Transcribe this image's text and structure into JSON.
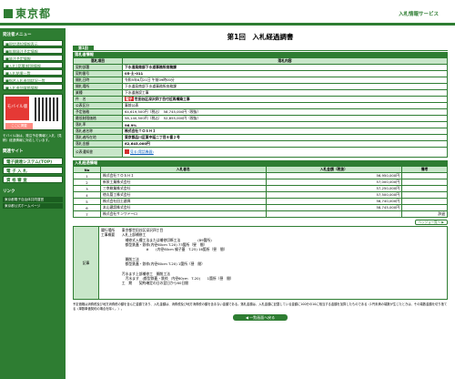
{
  "header": {
    "logo": "東京都",
    "right": "入札情報サービス"
  },
  "sidebar": {
    "menu_title": "発注者メニュー",
    "items": [
      "■現状通知情報表示",
      "■年間発注予定情報",
      "■発注予定情報",
      "■入札(見積)経過情報",
      "■入札結果一覧",
      "■指名入札参加状況一覧",
      "■入札参加資格情報"
    ],
    "mobile_logo": "モバイル版",
    "mobile_tag": "ここに掲載",
    "mobile_note": "モバイル版は、発注予定情報と入札（見積）経過情報に対応しています。",
    "links_title": "関連サイト",
    "big_buttons": [
      "電子調達システム(TOP)",
      "電 子 入 札",
      "資 格 審 査"
    ],
    "links_title2": "リンク",
    "small_links": [
      "東京都電子自治体共同運営",
      "東京都公式ホームページ"
    ]
  },
  "main": {
    "title": "第1回　入札経過調書",
    "tab": "第1回",
    "section1": "落札者情報",
    "head": {
      "k": "落札項目",
      "v": "落札内容"
    },
    "rows": [
      {
        "k": "契約部署",
        "v": "下水道局南部下水道事務所庶務課"
      },
      {
        "k": "契約番号",
        "v": "05-土-011"
      },
      {
        "k": "開札日時",
        "v": "令和5年8月21日 午前09時00分"
      },
      {
        "k": "開札場所",
        "v": "下水道局南部下水道事務所庶務課"
      },
      {
        "k": "業種",
        "v": "下水道施設工事"
      },
      {
        "k": "件　名",
        "v": "世田谷区深沢四丁目付近再構築工事",
        "tag": "電子"
      },
      {
        "k": "公表区分",
        "v": "事前公表"
      },
      {
        "k": "予定価格",
        "v": "64,619,500円（税込）　58,745,000円（税抜）"
      },
      {
        "k": "最低制限価格",
        "v": "58,140,500円（税込）　52,855,000円（税抜）"
      },
      {
        "k": "落札率",
        "v": "96.9%"
      },
      {
        "k": "落札者名称",
        "v": "株式会社ＴＯＳＨＩ"
      },
      {
        "k": "落札者所在地",
        "v": "東京都品川区東中延二丁目８番２号"
      },
      {
        "k": "落札金額",
        "v": "62,645,000円"
      },
      {
        "k": "公表通知書",
        "v": "見る(電話機器)"
      }
    ],
    "section2": "入札経過情報",
    "bid_head": {
      "no": "No",
      "name": "入札者名",
      "amount": "入札金額（税抜）",
      "remark": "備考"
    },
    "bids": [
      {
        "no": "1",
        "name": "株式会社ＴＯＳＨＩ",
        "amount": "56,950,000円",
        "remark": ""
      },
      {
        "no": "2",
        "name": "新栄工業株式会社",
        "amount": "57,000,000円",
        "remark": ""
      },
      {
        "no": "3",
        "name": "三幸総業株式会社",
        "amount": "57,250,000円",
        "remark": ""
      },
      {
        "no": "4",
        "name": "徳丸管工株式会社",
        "amount": "57,500,000円",
        "remark": ""
      },
      {
        "no": "5",
        "name": "株式会社田王建興",
        "amount": "58,740,000円",
        "remark": ""
      },
      {
        "no": "6",
        "name": "本山建設株式会社",
        "amount": "58,745,000円",
        "remark": ""
      },
      {
        "no": "7",
        "name": "株式会社サンワドーロ",
        "amount": "",
        "remark": "辞退"
      }
    ],
    "history_btn": "ヘッジョー覧へ ▶",
    "remarks_label": "記事",
    "remarks": "履行場所　　東京都世田谷区深沢四丁目\n工事概要　　入札上部補修工\n　　　　　　　補修式入槽工法または補修切断工法　　　　　(89箇所)\n　　　　　　　都型鉄蓋・鉄枠(内径60cm T-20) 73箇所（昼　間）\n　　　　　　　　　　　　　#　　(内径60cm 親子蓋　T-25) 16箇所（昼　間）\n\n　　　　　　　開削工法\n　　　　　　　都型鉄蓋・鉄枠(内径60cm T-20) 1箇所（昼　間）\n\n　　　　　　汚水ます上部補修工　開削工法\n　　　　　　　汚水ます　(都型鉄蓋・鉄枠　内径60cm　T-20)　　1箇所（昼　間）\n　　　　　　工　期　　契約確定の日の翌日から60日間",
    "note": "予定価格は消費税及び地方消費税の額を含んだ金額であり、入札金額は、消費税及び地方消費税の額を含まない金額である。落札金額は、入札金額に記載している金額に100分の10に相当する金額を加算したものである（1円未満の端数が生じたときは、その端数金額を切り捨てる（単数単価契約の場合を除く。）。",
    "back": "◀ 一覧画面へ戻る"
  }
}
